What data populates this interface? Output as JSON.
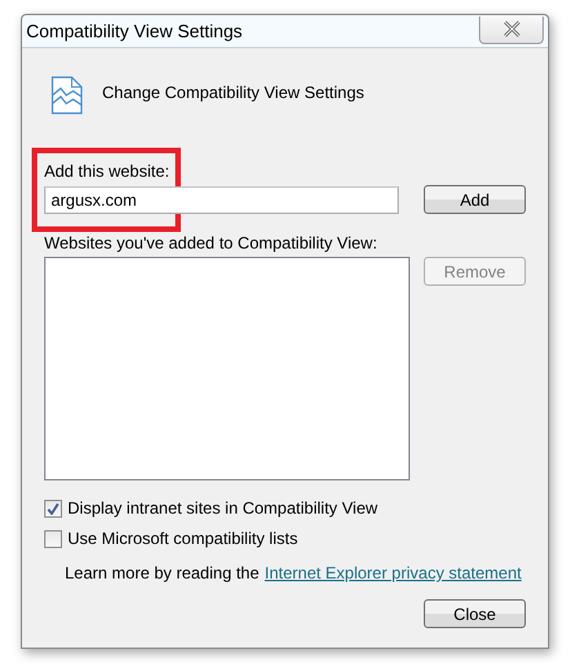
{
  "window": {
    "title": "Compatibility View Settings",
    "heading": "Change Compatibility View Settings"
  },
  "add_site": {
    "label": "Add this website:",
    "value": "argusx.com",
    "highlighted": true,
    "button": {
      "label": "Add",
      "disabled": false
    }
  },
  "sites_list": {
    "label": "Websites you've added to Compatibility View:",
    "button": {
      "label": "Remove",
      "disabled": true
    }
  },
  "options": [
    {
      "label": "Display intranet sites in Compatibility View",
      "checked": true
    },
    {
      "label": "Use Microsoft compatibility lists",
      "checked": false
    }
  ],
  "learn_more": {
    "text": "Learn more by reading the",
    "link": "Internet Explorer privacy statement"
  },
  "buttons": [
    {
      "label": "Close",
      "disabled": false
    }
  ]
}
